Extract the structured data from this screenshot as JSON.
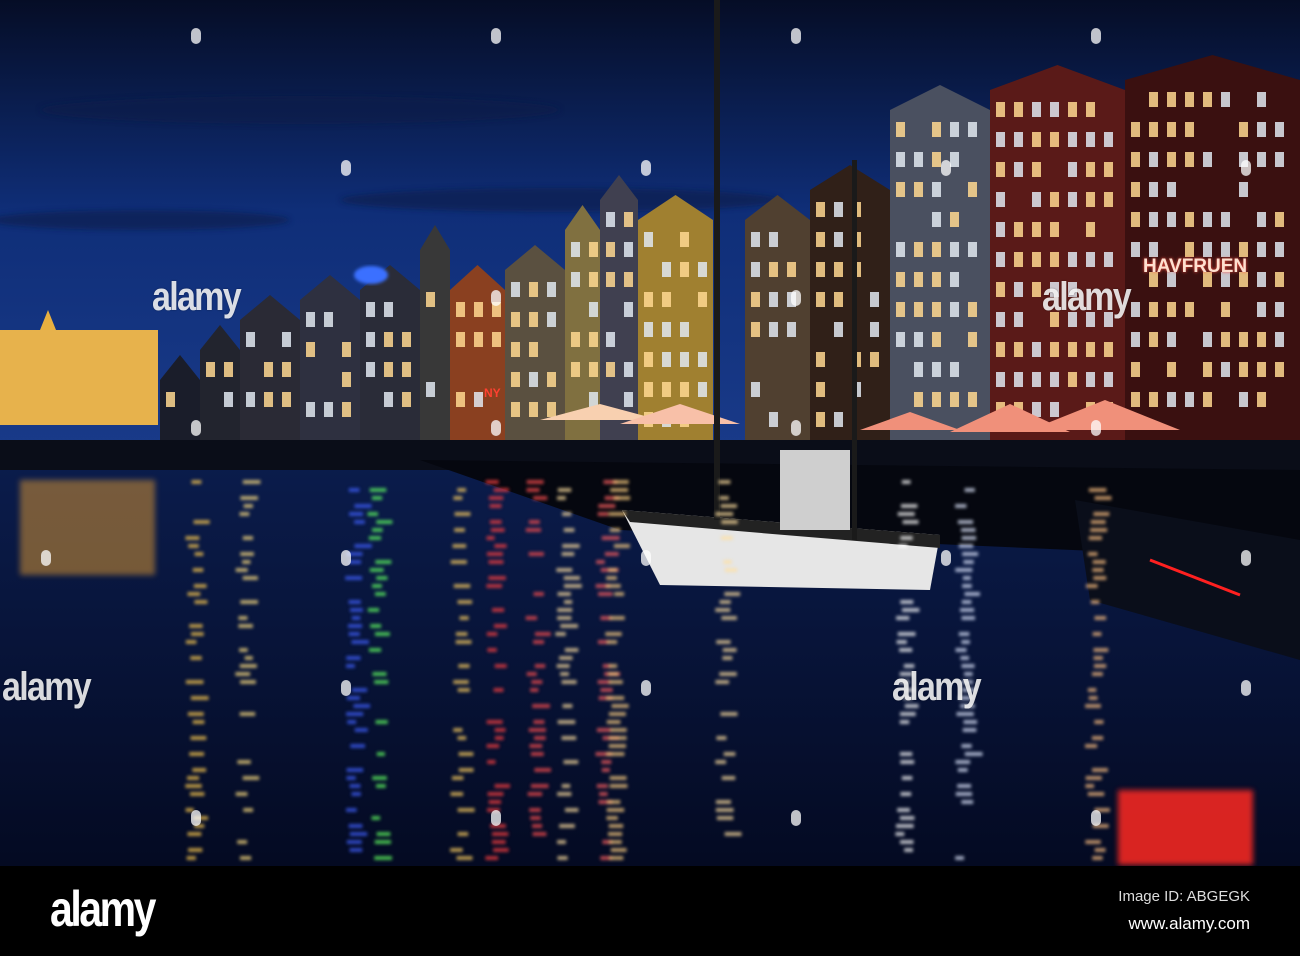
{
  "photo": {
    "signs": {
      "restaurant": "HAVFRUEN",
      "ny": "NY"
    },
    "colors": {
      "sky_top": "#07112e",
      "sky_mid": "#0f2e78",
      "water": "#061436",
      "neon_red": "#ff3020",
      "warm_light": "#ffc060"
    }
  },
  "watermarks": [
    "alamy",
    "alamy",
    "alamy",
    "alamy"
  ],
  "footer": {
    "logo": "alamy",
    "image_id": "Image ID: ABGEGK",
    "url": "www.alamy.com"
  }
}
